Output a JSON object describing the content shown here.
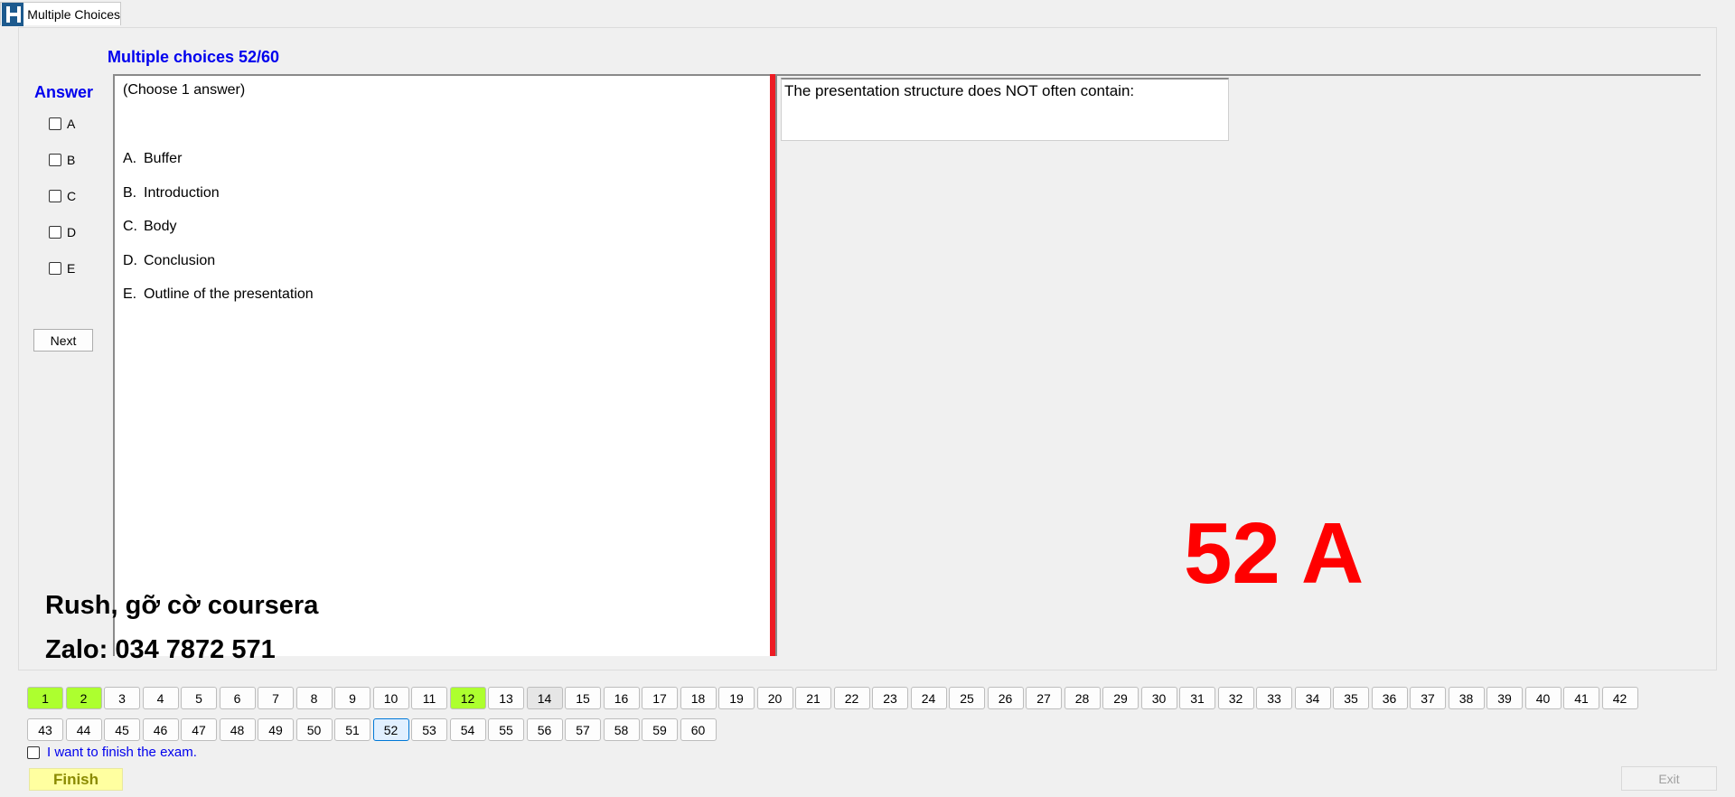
{
  "window": {
    "tab_label": "Multiple Choices",
    "logo_icon": "h-logo-icon"
  },
  "header": {
    "title": "Multiple choices 52/60"
  },
  "answer_panel": {
    "title": "Answer",
    "options": [
      "A",
      "B",
      "C",
      "D",
      "E"
    ],
    "next_label": "Next"
  },
  "choices": {
    "hint": "(Choose 1 answer)",
    "items": [
      {
        "key": "A.",
        "text": "Buffer"
      },
      {
        "key": "B.",
        "text": "Introduction"
      },
      {
        "key": "C.",
        "text": "Body"
      },
      {
        "key": "D.",
        "text": "Conclusion"
      },
      {
        "key": "E.",
        "text": "Outline of the presentation"
      }
    ]
  },
  "question": {
    "text": "The presentation structure does NOT often contain:"
  },
  "overlay": {
    "answer_key": "52 A",
    "line1": "Rush, gỡ cờ coursera",
    "line2": "Zalo: 034 7872 571"
  },
  "navigator": {
    "row1": [
      "1",
      "2",
      "3",
      "4",
      "5",
      "6",
      "7",
      "8",
      "9",
      "10",
      "11",
      "12",
      "13",
      "14",
      "15",
      "16",
      "17",
      "18",
      "19",
      "20",
      "21",
      "22",
      "23",
      "24",
      "25",
      "26",
      "27",
      "28",
      "29",
      "30",
      "31",
      "32",
      "33",
      "34",
      "35",
      "36",
      "37",
      "38",
      "39",
      "40",
      "41",
      "42"
    ],
    "row2": [
      "43",
      "44",
      "45",
      "46",
      "47",
      "48",
      "49",
      "50",
      "51",
      "52",
      "53",
      "54",
      "55",
      "56",
      "57",
      "58",
      "59",
      "60"
    ],
    "answered": [
      "1",
      "2",
      "12"
    ],
    "current": "52",
    "visited": [
      "14"
    ],
    "colors": {
      "answered": "#adff2f",
      "current_border": "#0078d7",
      "visited": "#e6e6e6"
    }
  },
  "footer": {
    "finish_check_label": "I want to finish the exam.",
    "finish_label": "Finish",
    "exit_label": "Exit"
  },
  "colors": {
    "accent_blue": "#0000ee",
    "red": "#ed1c24",
    "finish_bg": "#ffffa0"
  }
}
